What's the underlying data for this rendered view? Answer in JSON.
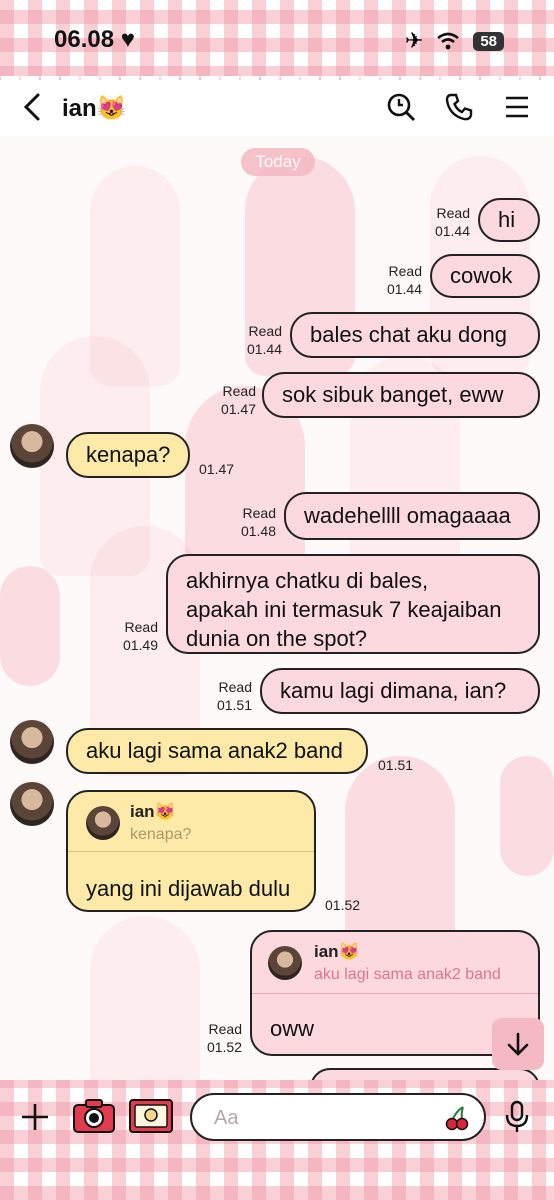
{
  "status_bar": {
    "time": "06.08",
    "battery": "58"
  },
  "header": {
    "title": "ian",
    "title_emoji": "😻"
  },
  "date_separator": "Today",
  "messages": [
    {
      "text": "hi",
      "read": "Read",
      "time": "01.44"
    },
    {
      "text": "cowok",
      "read": "Read",
      "time": "01.44"
    },
    {
      "text": "bales chat aku dong",
      "read": "Read",
      "time": "01.44"
    },
    {
      "text": "sok sibuk banget, eww",
      "read": "Read",
      "time": "01.47"
    },
    {
      "text": "kenapa?",
      "time": "01.47"
    },
    {
      "text": "wadehellll omagaaaa",
      "read": "Read",
      "time": "01.48"
    },
    {
      "lines": [
        "akhirnya chatku di bales,",
        "apakah ini termasuk 7 keajaiban",
        "dunia on the spot?"
      ],
      "read": "Read",
      "time": "01.49"
    },
    {
      "text": "kamu lagi dimana, ian?",
      "read": "Read",
      "time": "01.51"
    },
    {
      "text": "aku lagi sama anak2 band",
      "time": "01.51"
    },
    {
      "reply_name": "ian😻",
      "reply_quote": "kenapa?",
      "text": "yang ini dijawab dulu",
      "time": "01.52"
    },
    {
      "reply_name": "ian😻",
      "reply_quote": "aku lagi sama anak2 band",
      "text": "oww",
      "read": "Read",
      "time": "01.52"
    }
  ],
  "input": {
    "placeholder": "Aa"
  },
  "colors": {
    "outgoing": "#fcd9de",
    "incoming": "#fde9a8",
    "gingham": "#f096a5"
  },
  "icons": [
    "back-icon",
    "search-icon",
    "phone-icon",
    "menu-icon",
    "plus-icon",
    "camera-icon",
    "gallery-icon",
    "cherry-icon",
    "mic-icon",
    "arrow-down-icon",
    "airplane-icon",
    "wifi-icon",
    "heart-icon"
  ]
}
